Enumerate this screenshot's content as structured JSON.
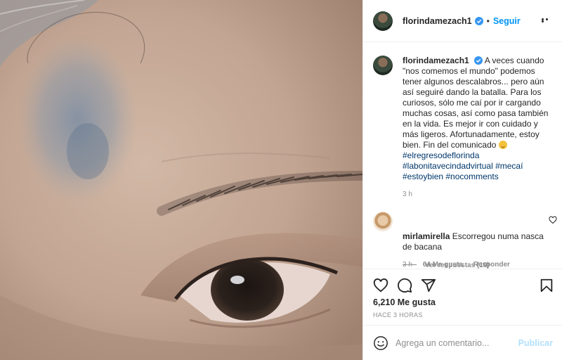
{
  "post": {
    "image_alt": "close-up of a face showing a bruise above an eyebrow and an eye"
  },
  "header": {
    "username": "florindamezach1",
    "separator": "•",
    "follow_label": "Seguir"
  },
  "caption": {
    "username": "florindamezach1",
    "text": "A veces cuando \"nos comemos el mundo\" podemos tener algunos descalabros... pero aún así seguiré dando la batalla. Para los curiosos, sólo me caí por ir cargando muchas cosas, así como pasa también en la vida. Es mejor ir con cuidado y más ligeros. Afortunadamente, estoy bien. Fin del comunicado",
    "hashtags_line1": "#elregresodeflorinda",
    "hashtags_line2": "#labonitavecindadvirtual #mecaí",
    "hashtags_line3": "#estoybien #nocomments",
    "time": "3 h"
  },
  "comment": {
    "username": "mirlamirella",
    "text": "Escorregou numa nasca de bacana",
    "time": "3 h",
    "likes": "64 Me gusta",
    "reply_label": "Responder",
    "view_replies": "Ver respuestas (10)"
  },
  "actions": {
    "likes_count": "6,210 Me gusta",
    "timestamp": "HACE 3 HORAS"
  },
  "add_comment": {
    "placeholder": "Agrega un comentario...",
    "publish_label": "Publicar"
  },
  "colors": {
    "accent": "#0095f6",
    "publish_disabled": "#b2dffc",
    "hashtag": "#00376b",
    "muted": "#8e8e8e"
  }
}
